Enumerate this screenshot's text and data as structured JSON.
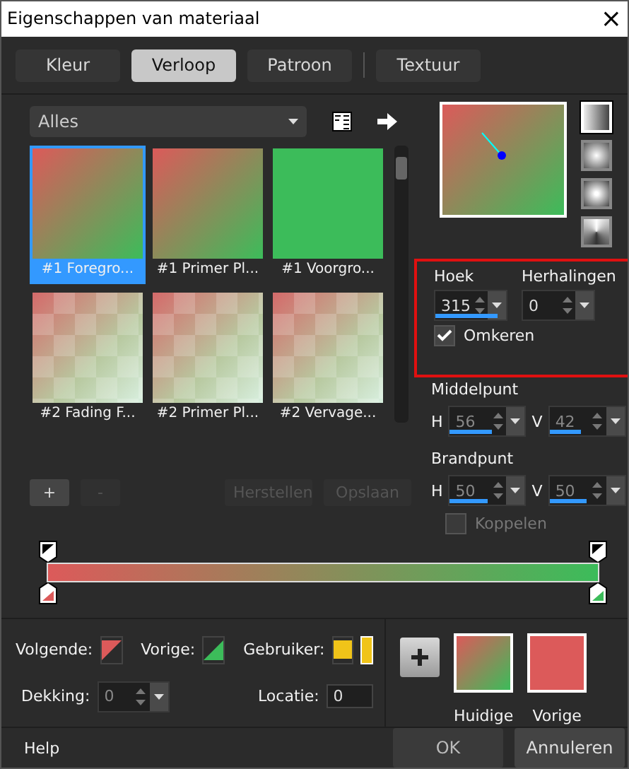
{
  "window": {
    "title": "Eigenschappen van materiaal",
    "close": "×"
  },
  "tabs": [
    {
      "label": "Kleur",
      "selected": false
    },
    {
      "label": "Verloop",
      "selected": true
    },
    {
      "label": "Patroon",
      "selected": false
    },
    {
      "label": "Textuur",
      "selected": false
    }
  ],
  "category": {
    "value": "Alles"
  },
  "gradients": [
    {
      "label": "#1 Foregro...",
      "kind": "diagonal",
      "selected": true
    },
    {
      "label": "#1 Primer Pl...",
      "kind": "diagonal",
      "selected": false
    },
    {
      "label": "#1 Voorgro...",
      "kind": "solid",
      "selected": false
    },
    {
      "label": "#2 Fading F...",
      "kind": "checker",
      "selected": false
    },
    {
      "label": "#2 Primer Pl...",
      "kind": "checker",
      "selected": false
    },
    {
      "label": "#2 Vervage...",
      "kind": "checker",
      "selected": false
    }
  ],
  "list_buttons": [
    {
      "label": "+",
      "disabled": false
    },
    {
      "label": "-",
      "disabled": true
    },
    {
      "label": "Herstellen",
      "disabled": true
    },
    {
      "label": "Opslaan",
      "disabled": true
    }
  ],
  "styles": [
    {
      "kind": "linear",
      "selected": true
    },
    {
      "kind": "rectangular",
      "selected": false
    },
    {
      "kind": "radial",
      "selected": false
    },
    {
      "kind": "sunburst",
      "selected": false
    }
  ],
  "angle_group": {
    "highlighted": true,
    "angle": {
      "label": "Hoek",
      "value": "315",
      "level": 0.88,
      "disabled": false
    },
    "repeats": {
      "label": "Herhalingen",
      "value": "0",
      "disabled": false
    },
    "reverse": {
      "label": "Omkeren",
      "checked": true
    }
  },
  "center": {
    "label": "Middelpunt",
    "h": {
      "axis": "H",
      "value": "56",
      "level": 0.56,
      "disabled": true
    },
    "v": {
      "axis": "V",
      "value": "42",
      "level": 0.42,
      "disabled": true
    }
  },
  "focal": {
    "label": "Brandpunt",
    "h": {
      "axis": "H",
      "value": "50",
      "level": 0.5,
      "disabled": true
    },
    "v": {
      "axis": "V",
      "value": "50",
      "level": 0.5,
      "disabled": true
    }
  },
  "link": {
    "label": "Koppelen",
    "checked": false,
    "disabled": true
  },
  "next": {
    "label": "Volgende:"
  },
  "previous": {
    "label": "Vorige:"
  },
  "user": {
    "label": "Gebruiker:"
  },
  "opacity": {
    "label": "Dekking:",
    "value": "0",
    "disabled": true
  },
  "location": {
    "label": "Locatie:",
    "value": "0"
  },
  "swatches": [
    {
      "label": "Huidige",
      "kind": "gradient"
    },
    {
      "label": "Vorige",
      "kind": "solid"
    }
  ],
  "footer": {
    "help": "Help",
    "ok": "OK",
    "cancel": "Annuleren"
  }
}
